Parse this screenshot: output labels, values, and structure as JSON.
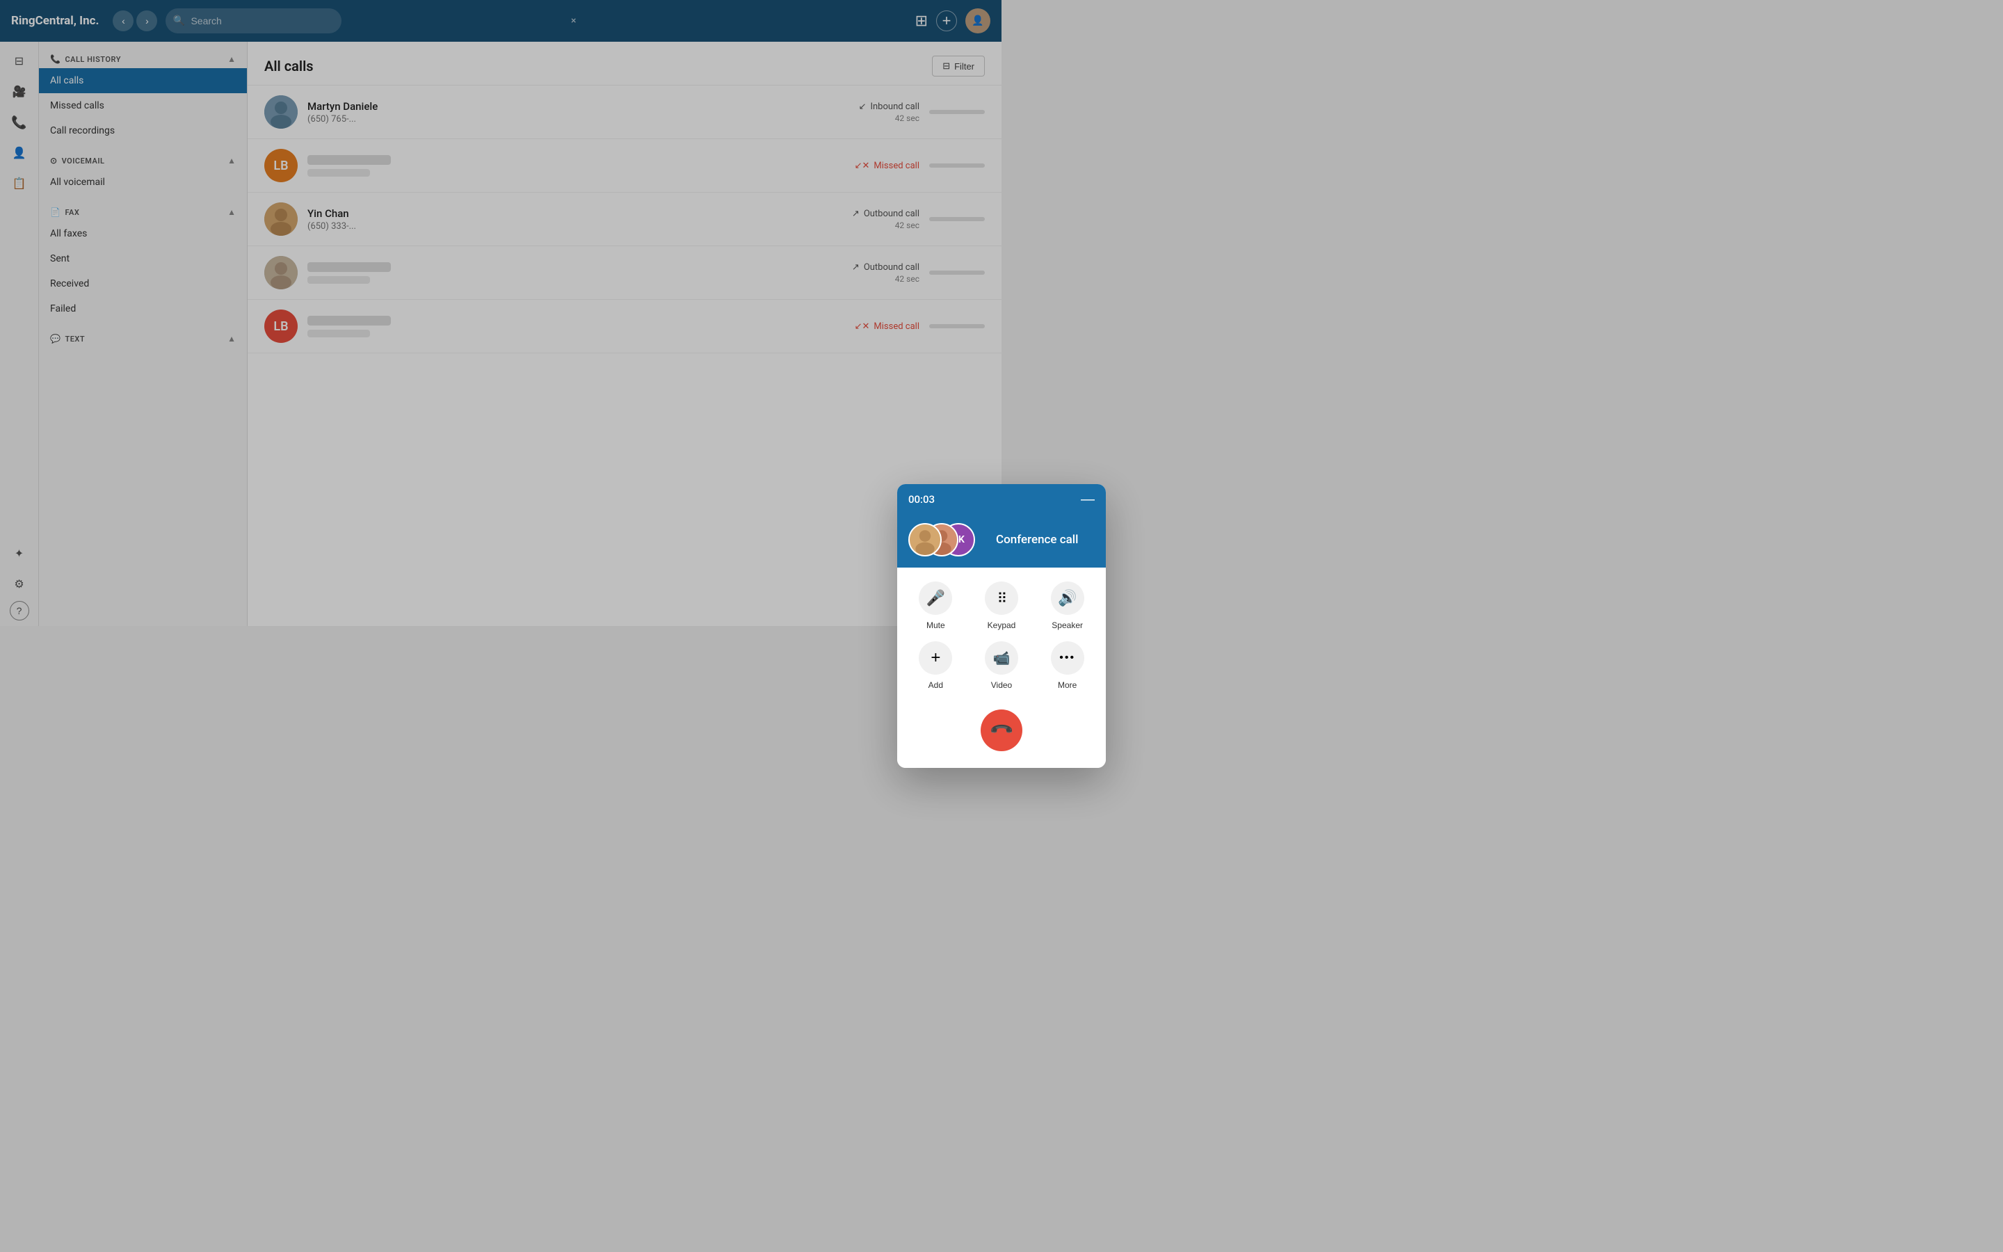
{
  "app": {
    "title": "RingCentral, Inc.",
    "search_placeholder": "Search",
    "search_clear": "×"
  },
  "topbar": {
    "back_label": "‹",
    "forward_label": "›",
    "grid_icon": "⊞",
    "add_icon": "+"
  },
  "icon_sidebar": {
    "items": [
      {
        "icon": "⊟",
        "name": "messaging-icon"
      },
      {
        "icon": "🎥",
        "name": "video-icon"
      },
      {
        "icon": "📞",
        "name": "phone-icon"
      },
      {
        "icon": "👤",
        "name": "contacts-icon"
      },
      {
        "icon": "📋",
        "name": "tasks-icon"
      }
    ],
    "bottom_items": [
      {
        "icon": "✦",
        "name": "extensions-icon"
      },
      {
        "icon": "⚙",
        "name": "settings-icon"
      },
      {
        "icon": "?",
        "name": "help-icon"
      }
    ]
  },
  "sidebar": {
    "call_history": {
      "section_label": "CALL HISTORY",
      "items": [
        {
          "label": "All calls",
          "active": true
        },
        {
          "label": "Missed calls"
        },
        {
          "label": "Call recordings"
        }
      ]
    },
    "voicemail": {
      "section_label": "VOICEMAIL",
      "items": [
        {
          "label": "All voicemail"
        }
      ]
    },
    "fax": {
      "section_label": "FAX",
      "items": [
        {
          "label": "All faxes"
        },
        {
          "label": "Sent"
        },
        {
          "label": "Received"
        },
        {
          "label": "Failed"
        }
      ]
    },
    "text": {
      "section_label": "TEXT"
    }
  },
  "main": {
    "title": "All calls",
    "filter_label": "Filter"
  },
  "call_list": {
    "calls": [
      {
        "id": 1,
        "name": "Martyn Daniele",
        "number": "(650) 765-...",
        "type": "Inbound call",
        "type_kind": "inbound",
        "duration": "42 sec",
        "avatar_type": "photo",
        "avatar_color": ""
      },
      {
        "id": 2,
        "name": "",
        "number": "",
        "type": "Missed call",
        "type_kind": "missed",
        "duration": "",
        "avatar_type": "initials",
        "avatar_initials": "LB",
        "avatar_color": "orange"
      },
      {
        "id": 3,
        "name": "Yin Chan",
        "number": "(650) 333-...",
        "type": "Outbound call",
        "type_kind": "outbound",
        "duration": "42 sec",
        "avatar_type": "photo",
        "avatar_color": ""
      },
      {
        "id": 4,
        "name": "",
        "number": "",
        "type": "Outbound call",
        "type_kind": "outbound",
        "duration": "42 sec",
        "avatar_type": "photo",
        "avatar_color": ""
      },
      {
        "id": 5,
        "name": "",
        "number": "",
        "type": "Missed call",
        "type_kind": "missed",
        "duration": "",
        "avatar_type": "initials",
        "avatar_initials": "LB",
        "avatar_color": "red"
      }
    ]
  },
  "call_modal": {
    "timer": "00:03",
    "minimize_icon": "—",
    "title": "Conference call",
    "controls": [
      {
        "icon": "🎤",
        "label": "Mute",
        "name": "mute-button"
      },
      {
        "icon": "⌨",
        "label": "Keypad",
        "name": "keypad-button"
      },
      {
        "icon": "🔊",
        "label": "Speaker",
        "name": "speaker-button"
      },
      {
        "icon": "+",
        "label": "Add",
        "name": "add-button"
      },
      {
        "icon": "📹",
        "label": "Video",
        "name": "video-button"
      },
      {
        "icon": "•••",
        "label": "More",
        "name": "more-button"
      }
    ],
    "end_icon": "📵"
  },
  "colors": {
    "accent_blue": "#1a6fa8",
    "topbar_blue": "#1a5276",
    "missed_red": "#e74c3c",
    "orange": "#e67e22"
  }
}
